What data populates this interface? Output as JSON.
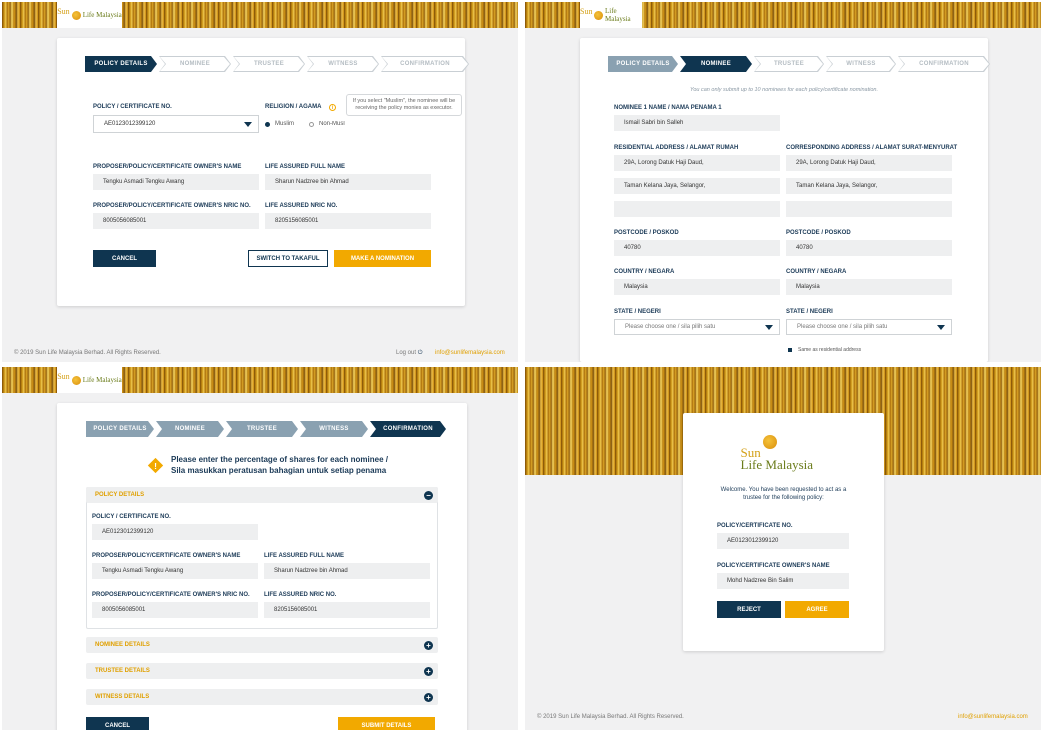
{
  "brand": {
    "logo_sun": "Sun",
    "logo_life": "Life Malaysia",
    "logo_full_sun": "Sun",
    "logo_full_life": "Life Malaysia"
  },
  "colors": {
    "navy": "#0f3550",
    "gold": "#f2a900",
    "accent_text": "#e0a000"
  },
  "footer": {
    "copyright": "© 2019 Sun Life Malaysia Berhad. All Rights Reserved.",
    "logout": "Log out",
    "email": "info@sunlifemalaysia.com"
  },
  "steps": {
    "policy": "Policy Details",
    "nominee": "Nominee",
    "trustee": "Trustee",
    "witness": "Witness",
    "confirmation": "Confirmation"
  },
  "policy_screen": {
    "policy_label": "POLICY / CERTIFICATE NO.",
    "policy_value": "AE0123012399120",
    "religion_label": "RELIGION / AGAMA",
    "religion_option_1": "Muslim",
    "religion_option_2": "Non-Musl",
    "religion_selected": "Muslim",
    "tooltip": "If you select \"Muslim\", the nominee will be receiving the policy monies as executor.",
    "owner_name_label": "PROPOSER/POLICY/CERTIFICATE OWNER'S NAME",
    "owner_name": "Tengku Asmadi Tengku Awang",
    "assured_name_label": "LIFE ASSURED FULL NAME",
    "assured_name": "Sharun Nadzree bin Ahmad",
    "owner_nric_label": "PROPOSER/POLICY/CERTIFICATE OWNER'S NRIC NO.",
    "owner_nric": "8005056085001",
    "assured_nric_label": "LIFE ASSURED NRIC NO.",
    "assured_nric": "8205156085001",
    "cancel": "CANCEL",
    "switch": "SWITCH TO TAKAFUL",
    "nominate": "MAKE A NOMINATION"
  },
  "nominee_screen": {
    "notice": "You can only submit up to 10 nominees for each policy/certificate nomination.",
    "name_label": "NOMINEE 1 NAME / NAMA PENAMA 1",
    "name_value": "Ismail Sabri bin Salleh",
    "res_label": "RESIDENTIAL ADDRESS / ALAMAT RUMAH",
    "res_line1": "29A, Lorong Datuk Haji Daud,",
    "res_line2": "Taman Kelana Jaya, Selangor,",
    "res_line3": "",
    "corr_label": "CORRESPONDING ADDRESS / ALAMAT SURAT-MENYURAT",
    "corr_line1": "29A, Lorong Datuk Haji Daud,",
    "corr_line2": "Taman Kelana Jaya, Selangor,",
    "corr_line3": "",
    "postcode_label": "POSTCODE / POSKOD",
    "postcode": "40780",
    "country_label": "COUNTRY / NEGARA",
    "country": "Malaysia",
    "state_label": "STATE / NEGERI",
    "state_placeholder": "Please choose one / sila pilih satu",
    "same_as": "Same as residential address"
  },
  "confirm_screen": {
    "title_1": "Please enter the percentage of shares for each nominee /",
    "title_2": "Sila masukkan peratusan bahagian untuk setiap penama",
    "policy_details": "POLICY DETAILS",
    "nominee_details": "NOMINEE DETAILS",
    "trustee_details": "TRUSTEE DETAILS",
    "witness_details": "WITNESS DETAILS",
    "cancel": "CANCEL",
    "submit": "SUBMIT DETAILS"
  },
  "trustee_screen": {
    "welcome_1": "Welcome. You have been requested to act as a",
    "welcome_2": "trustee for the following policy:",
    "policy_label": "POLICY/CERTIFICATE NO.",
    "policy_value": "AE0123012399120",
    "owner_label": "POLICY/CERTIFICATE OWNER'S NAME",
    "owner_value": "Mohd Nadzree Bin Salim",
    "reject": "REJECT",
    "agree": "AGREE"
  }
}
